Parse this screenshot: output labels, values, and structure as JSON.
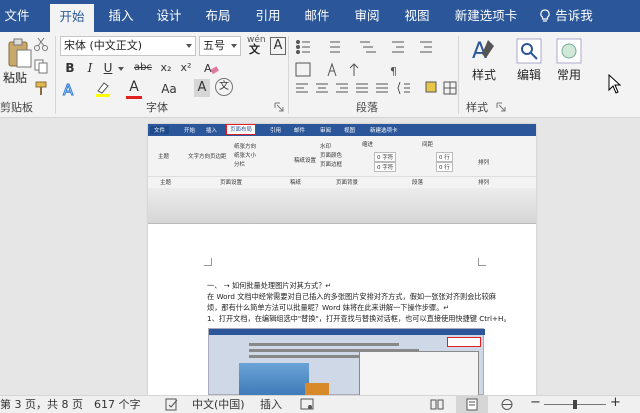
{
  "tabs": [
    {
      "label": "文件",
      "active": false
    },
    {
      "label": "开始",
      "active": true
    },
    {
      "label": "插入",
      "active": false
    },
    {
      "label": "设计",
      "active": false
    },
    {
      "label": "布局",
      "active": false
    },
    {
      "label": "引用",
      "active": false
    },
    {
      "label": "邮件",
      "active": false
    },
    {
      "label": "审阅",
      "active": false
    },
    {
      "label": "视图",
      "active": false
    },
    {
      "label": "新建选项卡",
      "active": false
    }
  ],
  "tell_me": "告诉我",
  "ribbon": {
    "clipboard": {
      "paste": "粘贴",
      "group": "剪贴板"
    },
    "font": {
      "name": "宋体 (中文正文)",
      "size": "五号",
      "wen": "wén",
      "wen_char": "文",
      "group": "字体",
      "bold": "B",
      "italic": "I",
      "underline": "U",
      "strike": "abc",
      "sub": "x₂",
      "sup": "x²",
      "aa": "Aa",
      "A": "A"
    },
    "paragraph": {
      "group": "段落"
    },
    "styles": {
      "label": "样式",
      "group": "样式"
    },
    "editing": {
      "label": "编辑"
    },
    "common": {
      "label": "常用"
    }
  },
  "document": {
    "embedded_tabs": [
      "文件",
      "开始",
      "插入",
      "页面布局",
      "引用",
      "邮件",
      "审阅",
      "视图",
      "新建选项卡"
    ],
    "embedded_groups": [
      "主题",
      "页面设置",
      "稿纸",
      "页面背景",
      "段落",
      "排列"
    ],
    "embedded_labels": {
      "wenzi": "文字方向",
      "yebianju": "页边距",
      "zhizhang_fangxiang": "纸张方向",
      "zhizhang_daxiao": "纸张大小",
      "fenlan": "分栏",
      "gaozhi": "稿纸设置",
      "shuiyin": "水印",
      "yemianyanse": "页面颜色",
      "yemianbiankuang": "页面边框",
      "suojin": "缩进",
      "jianju": "间距",
      "pailie": "排列",
      "zuo": "0 字符",
      "you": "0 字符",
      "duanqian": "0 行",
      "duanhou": "0 行",
      "theme": "主题"
    },
    "lines": [
      "一、 → 如何批量处理图片对其方式？↵",
      "在 Word 文档中经常需要对自己插入的多张图片安排对齐方式，假如一张张对齐则会比较麻",
      "烦，那有什么简单方法可以批量呢？Word 妹将在此来讲解一下操作步骤。↵",
      "1、打开文档，在编辑组选中\"替换\"，打开查找与替换对话框，也可以直接使用快捷键 Ctrl+H。"
    ]
  },
  "status": {
    "page": "第 3 页，共 8 页",
    "words": "617 个字",
    "lang": "中文(中国)",
    "mode": "插入"
  },
  "colors": {
    "accent": "#2b579a",
    "highlight_red": "#e02020"
  }
}
